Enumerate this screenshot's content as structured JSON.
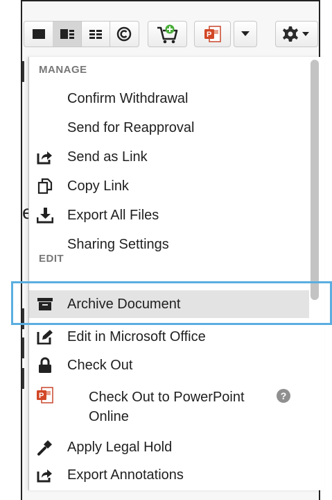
{
  "background": {
    "partial_letter": "e"
  },
  "toolbar": {
    "view_buttons": [
      {
        "icon": "large-tile-view-icon"
      },
      {
        "icon": "detail-list-view-icon"
      },
      {
        "icon": "grid-view-icon"
      },
      {
        "icon": "copyright-icon"
      }
    ],
    "cart_icon": "add-to-cart-icon",
    "powerpoint_icon": "powerpoint-icon",
    "settings_icon": "gear-icon"
  },
  "menu": {
    "manage_header": "MANAGE",
    "edit_header": "EDIT",
    "manage_items": [
      {
        "label": "Confirm Withdrawal",
        "icon": ""
      },
      {
        "label": "Send for Reapproval",
        "icon": ""
      },
      {
        "label": "Send as Link",
        "icon": "share-arrow-icon"
      },
      {
        "label": "Copy Link",
        "icon": "copy-icon"
      },
      {
        "label": "Export All Files",
        "icon": "download-icon"
      },
      {
        "label": "Sharing Settings",
        "icon": ""
      }
    ],
    "edit_items": [
      {
        "label": "Archive Document",
        "icon": "archive-box-icon"
      },
      {
        "label": "Edit in Microsoft Office",
        "icon": "edit-icon"
      },
      {
        "label": "Check Out",
        "icon": "lock-icon"
      },
      {
        "label": "Check Out to PowerPoint",
        "label_line2": "Online",
        "icon": "powerpoint-icon"
      },
      {
        "label": "Apply Legal Hold",
        "icon": "gavel-icon"
      },
      {
        "label": "Export Annotations",
        "icon": "share-arrow-icon"
      }
    ],
    "help_glyph": "?"
  },
  "colors": {
    "highlight_border": "#5aaee0",
    "hover_bg": "#e3e3e3",
    "header_text": "#777777"
  }
}
